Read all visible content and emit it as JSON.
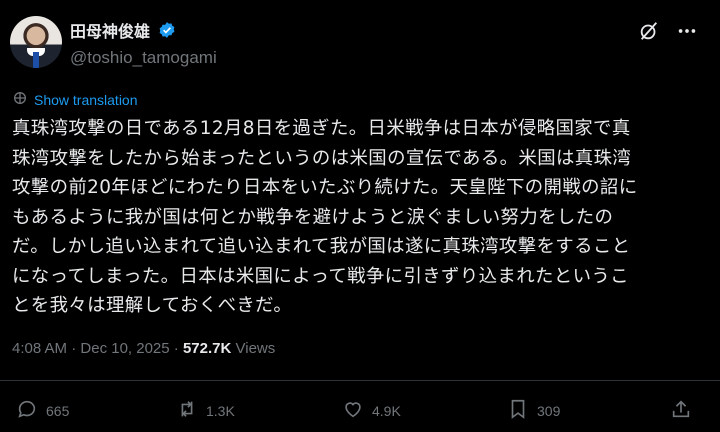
{
  "author": {
    "display_name": "田母神俊雄",
    "handle": "@toshio_tamogami"
  },
  "translate_label": "Show translation",
  "tweet_lines": [
    "真珠湾攻撃の日である12月8日を過ぎた。日米戦争は日本が侵略国家で真",
    "珠湾攻撃をしたから始まったというのは米国の宣伝である。米国は真珠湾",
    "攻撃の前20年ほどにわたり日本をいたぶり続けた。天皇陛下の開戦の詔に",
    "もあるように我が国は何とか戦争を避けようと涙ぐましい努力をしたの",
    "だ。しかし追い込まれて追い込まれて我が国は遂に真珠湾攻撃をすること",
    "になってしまった。日本は米国によって戦争に引きずり込まれたというこ",
    "とを我々は理解しておくべきだ。"
  ],
  "meta": {
    "time": "4:08 AM",
    "separator": "·",
    "date": "Dec 10, 2025",
    "views_count": "572.7K",
    "views_label": "Views"
  },
  "actions": {
    "replies": "665",
    "reposts": "1.3K",
    "likes": "4.9K",
    "bookmarks": "309"
  },
  "icons": {
    "verified": "verified-badge-icon",
    "grok": "grok-icon",
    "more": "more-icon",
    "translate": "translate-icon",
    "reply": "reply-icon",
    "repost": "repost-icon",
    "like": "like-icon",
    "bookmark": "bookmark-icon",
    "share": "share-icon"
  },
  "colors": {
    "background": "#000000",
    "text": "#e7e9ea",
    "secondary": "#71767b",
    "accent": "#1d9bf0"
  }
}
